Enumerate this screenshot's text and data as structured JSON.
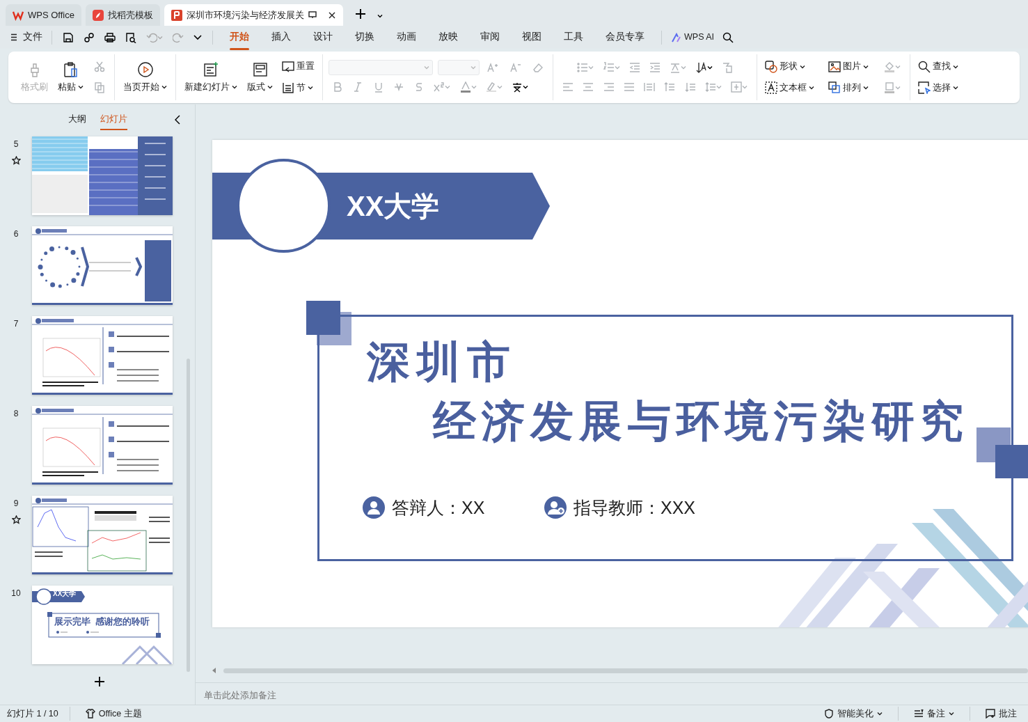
{
  "tabs": [
    {
      "label": "WPS Office",
      "kind": "home",
      "selected": false
    },
    {
      "label": "找稻壳模板",
      "kind": "template",
      "selected": false
    },
    {
      "label": "深圳市环境污染与经济发展关",
      "kind": "document",
      "selected": true
    }
  ],
  "file_menu": "文件",
  "menu": [
    {
      "label": "开始",
      "selected": true
    },
    {
      "label": "插入",
      "selected": false
    },
    {
      "label": "设计",
      "selected": false
    },
    {
      "label": "切换",
      "selected": false
    },
    {
      "label": "动画",
      "selected": false
    },
    {
      "label": "放映",
      "selected": false
    },
    {
      "label": "审阅",
      "selected": false
    },
    {
      "label": "视图",
      "selected": false
    },
    {
      "label": "工具",
      "selected": false
    },
    {
      "label": "会员专享",
      "selected": false
    }
  ],
  "ai_button": "WPS AI",
  "ribbon": {
    "clipboard": [
      {
        "label": "格式刷",
        "disabled": true,
        "dropdown": false
      },
      {
        "label": "粘贴",
        "disabled": false,
        "dropdown": true
      }
    ],
    "play": [
      {
        "label": "当页开始",
        "disabled": false,
        "dropdown": true
      }
    ],
    "slides": [
      {
        "label": "新建幻灯片",
        "disabled": false,
        "dropdown": true
      },
      {
        "label": "版式",
        "disabled": false,
        "dropdown": true
      },
      {
        "label": "重置",
        "disabled": false,
        "dropdown": false
      },
      {
        "label": "节",
        "disabled": false,
        "dropdown": true
      }
    ],
    "insert": [
      {
        "label": "形状",
        "disabled": false,
        "dropdown": true
      },
      {
        "label": "图片",
        "disabled": false,
        "dropdown": true
      },
      {
        "label": "文本框",
        "disabled": false,
        "dropdown": true
      },
      {
        "label": "排列",
        "disabled": false,
        "dropdown": true
      }
    ],
    "edit": [
      {
        "label": "查找",
        "disabled": false,
        "dropdown": true
      },
      {
        "label": "选择",
        "disabled": false,
        "dropdown": true
      }
    ]
  },
  "panel_tabs": [
    {
      "label": "大纲",
      "selected": false
    },
    {
      "label": "幻灯片",
      "selected": true
    }
  ],
  "thumbnails": [
    {
      "number": "5",
      "kind": "table",
      "animated": true
    },
    {
      "number": "6",
      "kind": "diagram",
      "animated": false
    },
    {
      "number": "7",
      "kind": "chart",
      "animated": false
    },
    {
      "number": "8",
      "kind": "chart",
      "animated": false
    },
    {
      "number": "9",
      "kind": "dual-chart",
      "animated": true
    },
    {
      "number": "10",
      "kind": "closing",
      "animated": false,
      "banner": "XX大学",
      "heading": "展示完毕  感谢您的聆听"
    }
  ],
  "slide": {
    "banner": "XX大学",
    "title_line_1": "深圳市",
    "title_line_2": "经济发展与环境污染研究",
    "presenter": "答辩人：XX",
    "advisor": "指导教师：XXX"
  },
  "notes_placeholder": "单击此处添加备注",
  "status_bar": {
    "slide_counter": "幻灯片 1 / 10",
    "theme": "Office 主题",
    "right": [
      {
        "label": "智能美化",
        "dropdown": true
      },
      {
        "label": "备注",
        "dropdown": true
      },
      {
        "label": "批注",
        "dropdown": false
      }
    ]
  }
}
